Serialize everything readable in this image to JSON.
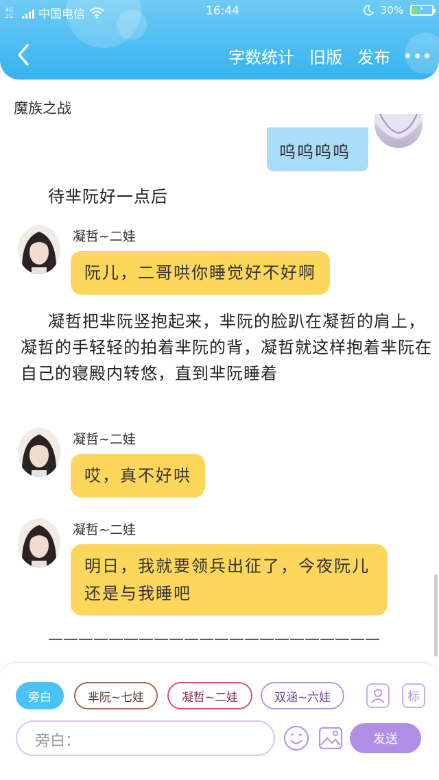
{
  "status_bar": {
    "network_small": "4G 2G",
    "carrier": "中国电信",
    "time": "16:44",
    "battery": "30%",
    "battery_level": 0.3
  },
  "header": {
    "nav_items": [
      "字数统计",
      "旧版",
      "发布"
    ],
    "back_icon": "chevron-left-icon",
    "more_icon": "more-dots-icon"
  },
  "doc_title": "魔族之战",
  "my_message": "呜呜呜呜",
  "narrations": [
    "待芈阮好一点后",
    "凝哲把芈阮竖抱起来，芈阮的脸趴在凝哲的肩上，凝哲的手轻轻的拍着芈阮的背，凝哲就这样抱着芈阮在自己的寝殿内转悠，直到芈阮睡着"
  ],
  "messages": [
    {
      "speaker": "凝哲~二娃",
      "text": "阮儿，二哥哄你睡觉好不好啊"
    },
    {
      "speaker": "凝哲~二娃",
      "text": "哎，真不好哄"
    },
    {
      "speaker": "凝哲~二娃",
      "text": "明日，我就要领兵出征了，今夜阮儿还是与我睡吧"
    }
  ],
  "divider": "——————————————————————",
  "bottom": {
    "chips": [
      "旁白",
      "芈阮~七娃",
      "凝哲~二娃",
      "双涵~六娃"
    ],
    "tag_icon_label": "标",
    "input_placeholder": "旁白：",
    "send_label": "发送"
  },
  "colors": {
    "header": "#36b3ef",
    "yellow_bubble": "#fcd75c",
    "blue_bubble": "#a9dcf8",
    "send": "#b08ee6"
  }
}
